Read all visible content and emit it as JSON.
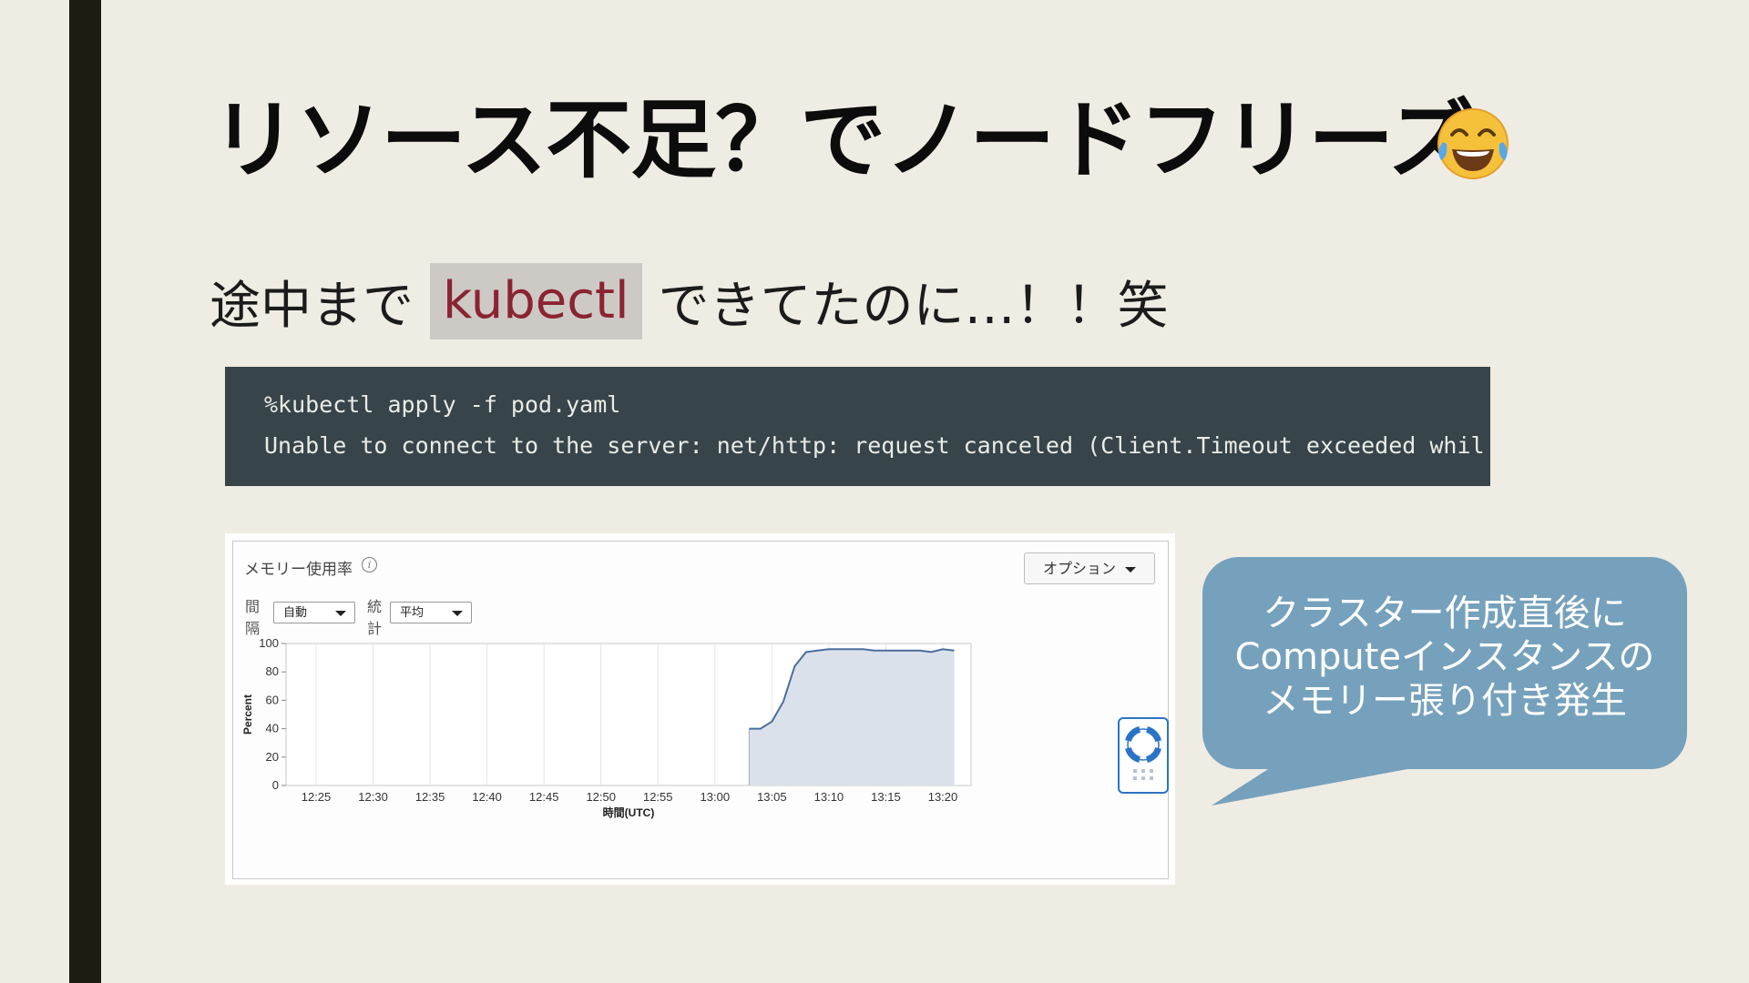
{
  "slide": {
    "title": "リソース不足？でノードフリーズ",
    "title_emoji": "face-with-tears-of-joy-icon",
    "subtitle_before": "途中まで",
    "subtitle_code": "kubectl",
    "subtitle_after": "できてたのに…！！笑"
  },
  "code_block": {
    "line1": "%kubectl apply -f pod.yaml",
    "line2": "Unable to connect to the server: net/http: request canceled (Client.Timeout exceeded whil"
  },
  "console": {
    "panel_title": "メモリー使用率",
    "option_button": "オプション",
    "interval_label": [
      "間",
      "隔"
    ],
    "interval_value": "自動",
    "stat_label": [
      "統",
      "計"
    ],
    "stat_value": "平均"
  },
  "chart_data": {
    "type": "area",
    "title": "",
    "ylabel": "Percent",
    "xlabel": "時間(UTC)",
    "ylim": [
      0,
      100
    ],
    "y_ticks": [
      0,
      20,
      40,
      60,
      80,
      100
    ],
    "x_ticks": [
      "12:25",
      "12:30",
      "12:35",
      "12:40",
      "12:45",
      "12:50",
      "12:55",
      "13:00",
      "13:05",
      "13:10",
      "13:15",
      "13:20"
    ],
    "grid": true,
    "series": [
      {
        "color": "#4a6e9e",
        "fill": "#dbe1ea",
        "points": [
          [
            "13:03",
            40
          ],
          [
            "13:04",
            40
          ],
          [
            "13:05",
            45
          ],
          [
            "13:06",
            59
          ],
          [
            "13:07",
            84
          ],
          [
            "13:08",
            94
          ],
          [
            "13:09",
            95
          ],
          [
            "13:10",
            96
          ],
          [
            "13:11",
            96
          ],
          [
            "13:12",
            96
          ],
          [
            "13:13",
            96
          ],
          [
            "13:14",
            95
          ],
          [
            "13:15",
            95
          ],
          [
            "13:16",
            95
          ],
          [
            "13:17",
            95
          ],
          [
            "13:18",
            95
          ],
          [
            "13:19",
            94
          ],
          [
            "13:20",
            96
          ],
          [
            "13:21",
            95
          ]
        ]
      }
    ]
  },
  "bubble": {
    "line1": "クラスター作成直後に",
    "line2": "Computeインスタンスの",
    "line3": "メモリー張り付き発生"
  },
  "colors": {
    "background": "#efece4",
    "left_bar": "#1d1c12",
    "code_bg": "#37444a",
    "bubble": "#76a1bc",
    "inline_code_text": "#8b2332"
  }
}
